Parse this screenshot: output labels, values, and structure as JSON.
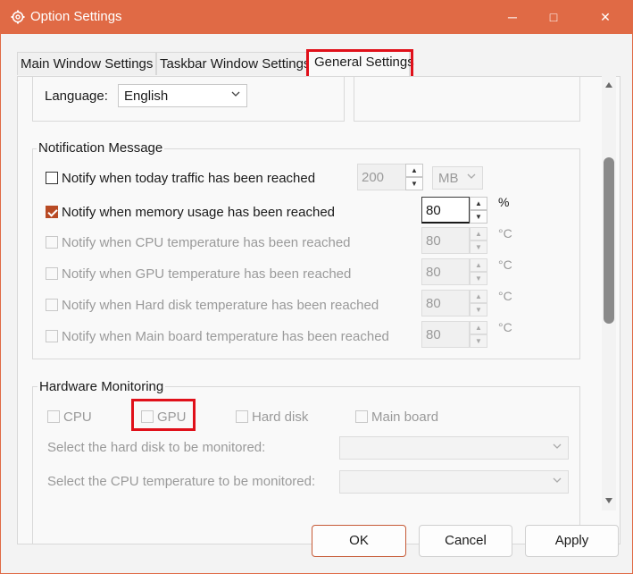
{
  "window": {
    "title": "Option Settings",
    "minimize": "─",
    "maximize": "□",
    "close": "✕"
  },
  "tabs": [
    {
      "label": "Main Window Settings",
      "selected": false
    },
    {
      "label": "Taskbar Window Settings",
      "selected": false
    },
    {
      "label": "General Settings",
      "selected": true
    }
  ],
  "language": {
    "label": "Language:",
    "value": "English"
  },
  "notification": {
    "title": "Notification Message",
    "traffic": {
      "label": "Notify when today traffic has been reached",
      "checked": false,
      "value": "200",
      "unit": "MB"
    },
    "memory": {
      "label": "Notify when memory usage has been reached",
      "checked": true,
      "value": "80",
      "unit": "%"
    },
    "cpu_temp": {
      "label": "Notify when CPU temperature has been reached",
      "checked": false,
      "value": "80",
      "unit": "°C"
    },
    "gpu_temp": {
      "label": "Notify when GPU temperature has been reached",
      "checked": false,
      "value": "80",
      "unit": "°C"
    },
    "disk_temp": {
      "label": "Notify when Hard disk temperature has been reached",
      "checked": false,
      "value": "80",
      "unit": "°C"
    },
    "board_temp": {
      "label": "Notify when Main board temperature has been reached",
      "checked": false,
      "value": "80",
      "unit": "°C"
    }
  },
  "hardware": {
    "title": "Hardware Monitoring",
    "cpu": "CPU",
    "gpu": "GPU",
    "hard_disk": "Hard disk",
    "main_board": "Main board",
    "disk_select_label": "Select the hard disk to be monitored:",
    "cpu_temp_select_label": "Select the CPU temperature to be monitored:"
  },
  "buttons": {
    "ok": "OK",
    "cancel": "Cancel",
    "apply": "Apply"
  },
  "colors": {
    "titlebar": "#e06a45",
    "highlight": "#e0101a",
    "checkbox_checked": "#b84a24"
  }
}
